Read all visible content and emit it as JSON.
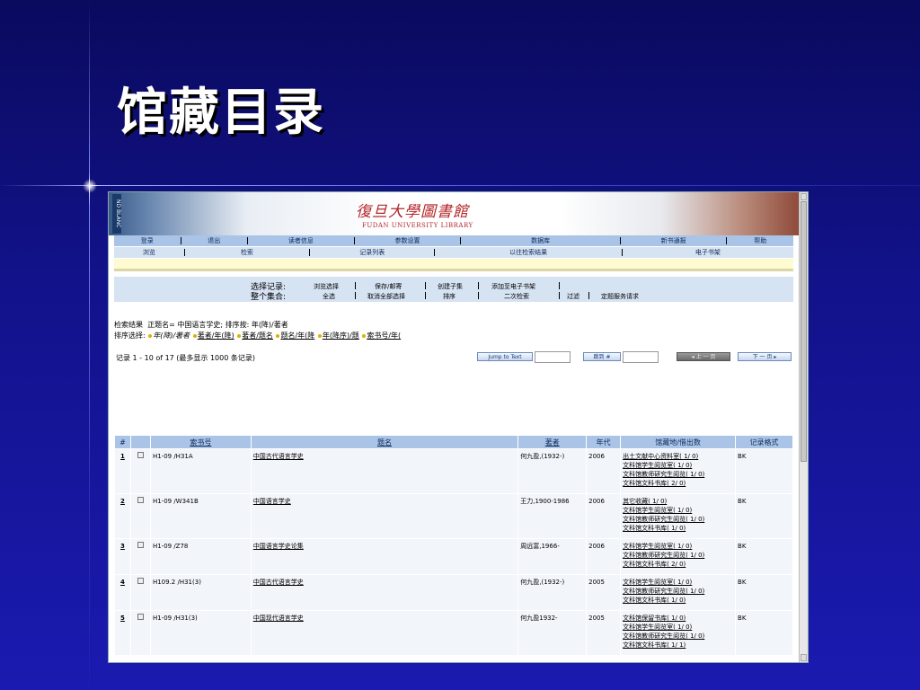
{
  "slide": {
    "title": "馆藏目录"
  },
  "banner": {
    "side_text": "ND BLANC",
    "logo_cn": "復旦大學圖書館",
    "logo_en": "FUDAN UNIVERSITY LIBRARY"
  },
  "nav_primary": [
    "登录",
    "退出",
    "读者信息",
    "参数设置",
    "数据库",
    "新书通报",
    "帮助"
  ],
  "nav_secondary": [
    "浏览",
    "检索",
    "记录列表",
    "以往检索结果",
    "电子书架"
  ],
  "selection": {
    "select_records_label": "选择记录:",
    "whole_set_label": "整个集合:",
    "record_actions": [
      "浏览选择",
      "保存/邮寄",
      "创建子集",
      "添加至电子书架"
    ],
    "set_actions": [
      "全选",
      "取消全部选择",
      "排序",
      "二次检索",
      "过滤",
      "定题服务请求"
    ]
  },
  "results": {
    "result_label": "检索结果",
    "result_query": "正题名= 中国语言学史; 排序按: 年(降)/著者",
    "sort_label": "排序选择:",
    "sort_options": [
      "年(降)/著者",
      "著者/年(降)",
      "著者/题名",
      "题名/年(降",
      "年(降序)/题",
      "索书号/年("
    ],
    "record_info": "记录   1 - 10 of 17 (最多显示   1000 条记录)",
    "jump_to_text_button": "Jump to Text",
    "jump_to_number_button": "跳到 #",
    "prev_page_button": "上 一 页",
    "next_page_button": "下 一 页"
  },
  "table": {
    "headers": [
      "#",
      "",
      "索书号",
      "题名",
      "著者",
      "年代",
      "馆藏地/借出数",
      "记录格式"
    ],
    "rows": [
      {
        "num": "1",
        "call": "H1-09 /H31A",
        "title": "中国古代语言学史",
        "author": "何九盈,(1932-)",
        "year": "2006",
        "locations": [
          "出土文献中心资料室( 1/ 0)",
          "文科馆学生阅览室( 1/ 0)",
          "文科馆教师研究生阅览( 1/ 0)",
          "文科馆文科书库( 2/ 0)"
        ],
        "format": "BK"
      },
      {
        "num": "2",
        "call": "H1-09 /W341B",
        "title": "中国语言学史",
        "author": "王力,1900-1986",
        "year": "2006",
        "locations": [
          "其它收藏( 1/ 0)",
          "文科馆学生阅览室( 1/ 0)",
          "文科馆教师研究生阅览( 1/ 0)",
          "文科馆文科书库( 1/ 0)"
        ],
        "format": "BK"
      },
      {
        "num": "3",
        "call": "H1-09 /Z78",
        "title": "中国语言学史论集",
        "author": "周远富,1966-",
        "year": "2006",
        "locations": [
          "文科馆学生阅览室( 1/ 0)",
          "文科馆教师研究生阅览( 1/ 0)",
          "文科馆文科书库( 2/ 0)"
        ],
        "format": "BK"
      },
      {
        "num": "4",
        "call": "H109.2 /H31(3)",
        "title": "中国古代语言学史",
        "author": "何九盈,(1932-)",
        "year": "2005",
        "locations": [
          "文科馆学生阅览室( 1/ 0)",
          "文科馆教师研究生阅览( 1/ 0)",
          "文科馆文科书库( 1/ 0)"
        ],
        "format": "BK"
      },
      {
        "num": "5",
        "call": "H1-09 /H31(3)",
        "title": "中国现代语言学史",
        "author": "何九盈1932-",
        "year": "2005",
        "locations": [
          "文科馆保留书库( 1/ 0)",
          "文科馆学生阅览室( 1/ 0)",
          "文科馆教师研究生阅览( 1/ 0)",
          "文科馆文科书库( 1/ 1)"
        ],
        "format": "BK"
      }
    ]
  }
}
